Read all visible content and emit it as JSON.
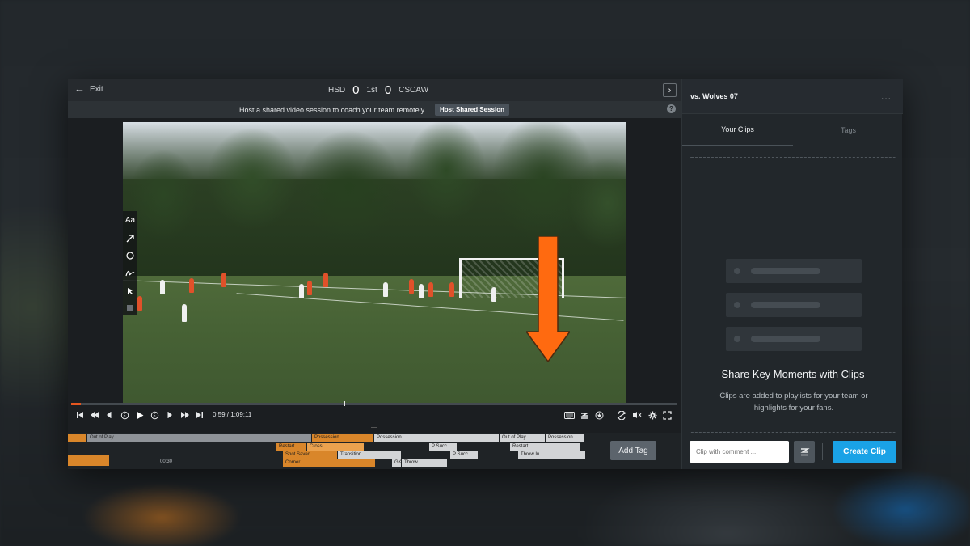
{
  "header": {
    "exit_label": "Exit",
    "home_team": "HSD",
    "home_score": "0",
    "period": "1st",
    "away_score": "0",
    "away_team": "CSCAW"
  },
  "notice": {
    "text": "Host a shared video session to coach your team remotely.",
    "button_label": "Host Shared Session",
    "help_icon": "?"
  },
  "tools": {
    "text_tool_label": "Aa"
  },
  "player": {
    "current_time": "0:59",
    "duration": "1:09:11",
    "time_display": "0:59 / 1:09:11",
    "progress_fraction": 0.016,
    "accent_color": "#e5561f"
  },
  "timeline": {
    "time_marker": "00:30",
    "row1": [
      "Out of Play",
      "Possession",
      "Possession",
      "Out of Play",
      "Possession"
    ],
    "row2": [
      "Restart",
      "Cross",
      "P Succ...",
      "Restart"
    ],
    "row3": [
      "Shot Saved",
      "Transition",
      "P Succ...",
      "Throw In"
    ],
    "row4": [
      "Corner",
      "GK",
      "Throw"
    ],
    "add_tag_label": "Add Tag"
  },
  "sidebar": {
    "title": "vs. Wolves 07",
    "more_icon": "...",
    "tabs": [
      {
        "label": "Your Clips",
        "active": true
      },
      {
        "label": "Tags",
        "active": false
      }
    ],
    "empty_title": "Share Key Moments with Clips",
    "empty_text": "Clips are added to playlists for your team or highlights for your fans.",
    "comment_placeholder": "Clip with comment ...",
    "create_label": "Create Clip",
    "create_color": "#1aa2e6"
  }
}
